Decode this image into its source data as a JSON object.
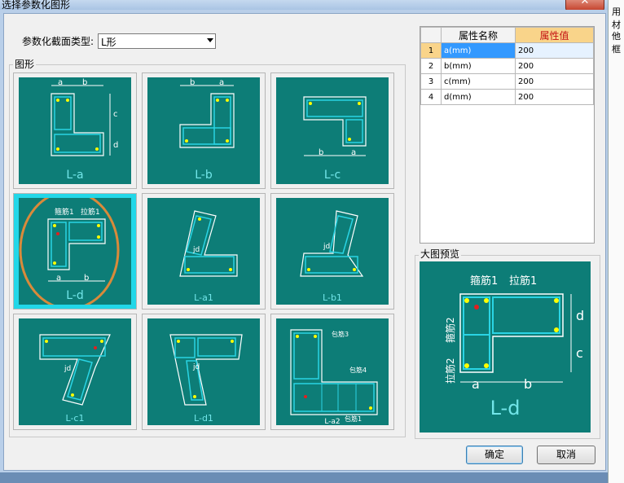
{
  "window": {
    "title": "选择参数化图形",
    "close": "✕"
  },
  "right_strip": [
    "用材",
    "他框"
  ],
  "section_type": {
    "label": "参数化截面类型:",
    "value": "L形"
  },
  "group_label": "图形",
  "shapes": [
    {
      "caption": "L-a"
    },
    {
      "caption": "L-b"
    },
    {
      "caption": "L-c"
    },
    {
      "caption": "L-d"
    },
    {
      "caption": "L-a1"
    },
    {
      "caption": "L-b1"
    },
    {
      "caption": "L-c1"
    },
    {
      "caption": "L-d1"
    },
    {
      "caption": "L-a2"
    }
  ],
  "diagram_labels": {
    "a": "a",
    "b": "b",
    "c": "c",
    "d": "d",
    "gujin1": "箍筋1",
    "gujin2": "箍筋2",
    "lajin1": "拉筋1",
    "lajin2": "拉筋2",
    "baojin3": "包筋3",
    "baojin4": "包筋4",
    "baojin1": "包筋1",
    "jd": "jd"
  },
  "grid": {
    "headers": [
      "属性名称",
      "属性值"
    ],
    "rows": [
      {
        "n": "1",
        "name": "a(mm)",
        "value": "200"
      },
      {
        "n": "2",
        "name": "b(mm)",
        "value": "200"
      },
      {
        "n": "3",
        "name": "c(mm)",
        "value": "200"
      },
      {
        "n": "4",
        "name": "d(mm)",
        "value": "200"
      }
    ]
  },
  "preview": {
    "label": "大图预览",
    "caption": "L-d"
  },
  "buttons": {
    "ok": "确定",
    "cancel": "取消"
  },
  "colors": {
    "panel": "#0d7d77",
    "selected": "#22d7e8",
    "caption": "#72e5e9",
    "annotation": "#d98a3a",
    "header_value_bg": "#f9d48a",
    "row_selected": "#3399ff"
  }
}
